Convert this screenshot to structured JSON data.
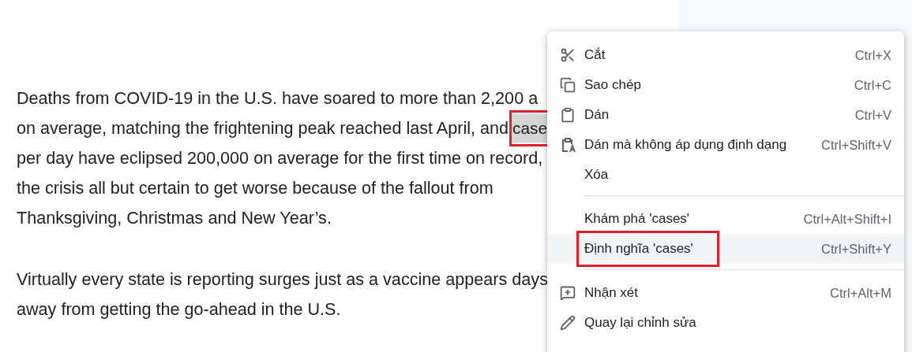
{
  "document": {
    "paragraphs": [
      {
        "lines": [
          {
            "text": "Deaths from COVID-19 in the U.S. have soared to more than 2,200 a"
          },
          {
            "text": "on average, matching the frightening peak reached last April, and",
            "highlight": "case",
            "annotated": true
          },
          {
            "text": "per day have eclipsed 200,000 on average for the first time on record,"
          },
          {
            "text": "the crisis all but certain to get worse because of the fallout from"
          },
          {
            "text": "Thanksgiving, Christmas and New Year’s."
          }
        ]
      },
      {
        "lines": [
          {
            "text": "Virtually every state is reporting surges just as a vaccine appears days"
          },
          {
            "text": "away from getting the go-ahead in the U.S."
          }
        ]
      }
    ]
  },
  "context_menu": {
    "groups": [
      [
        {
          "kind": "cut",
          "label": "Cắt",
          "shortcut": "Ctrl+X",
          "selected": false,
          "annotated": false
        },
        {
          "kind": "copy",
          "label": "Sao chép",
          "shortcut": "Ctrl+C",
          "selected": false,
          "annotated": false
        },
        {
          "kind": "paste",
          "label": "Dán",
          "shortcut": "Ctrl+V",
          "selected": false,
          "annotated": false
        },
        {
          "kind": "pasteplain",
          "label": "Dán mà không áp dụng định dạng",
          "shortcut": "Ctrl+Shift+V",
          "selected": false,
          "annotated": false
        },
        {
          "kind": "plain",
          "label": "Xóa",
          "selected": false,
          "annotated": false
        }
      ],
      [
        {
          "kind": "plain",
          "label": "Khám phá 'cases'",
          "shortcut": "Ctrl+Alt+Shift+I",
          "selected": false,
          "annotated": false
        },
        {
          "kind": "plain",
          "label": "Định nghĩa 'cases'",
          "shortcut": "Ctrl+Shift+Y",
          "selected": true,
          "annotated": true
        }
      ],
      [
        {
          "kind": "comment",
          "label": "Nhận xét",
          "shortcut": "Ctrl+Alt+M",
          "selected": false,
          "annotated": false
        },
        {
          "kind": "edit",
          "label": "Quay lại chỉnh sửa",
          "selected": false,
          "annotated": false
        }
      ]
    ]
  }
}
